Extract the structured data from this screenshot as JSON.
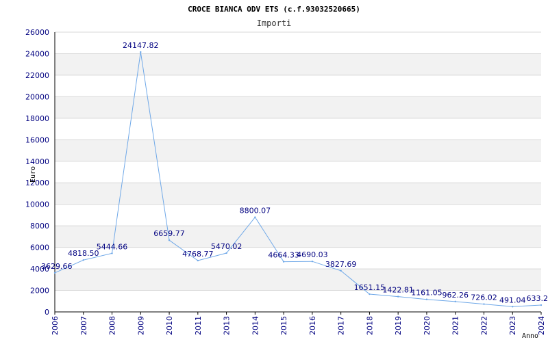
{
  "chart_data": {
    "type": "line",
    "title": "CROCE BIANCA ODV ETS (c.f.93032520665)",
    "subtitle": "Importi",
    "ylabel": "Euro",
    "xlabel": "Anno",
    "ylim": [
      0,
      26000
    ],
    "yticks": [
      0,
      2000,
      4000,
      6000,
      8000,
      10000,
      12000,
      14000,
      16000,
      18000,
      20000,
      22000,
      24000,
      26000
    ],
    "x": [
      "2006",
      "2007",
      "2008",
      "2009",
      "2010",
      "2011",
      "2013",
      "2014",
      "2015",
      "2016",
      "2017",
      "2018",
      "2019",
      "2020",
      "2021",
      "2022",
      "2023",
      "2024"
    ],
    "values": [
      3629.66,
      4818.5,
      5444.66,
      24147.82,
      6659.77,
      4768.77,
      5470.02,
      8800.07,
      4664.33,
      4690.03,
      3827.69,
      1651.15,
      1422.81,
      1161.05,
      962.26,
      726.02,
      491.04,
      633.2
    ],
    "labels": [
      "3629.66",
      "4818.50",
      "5444.66",
      "24147.82",
      "6659.77",
      "4768.77",
      "5470.02",
      "8800.07",
      "4664.33",
      "4690.03",
      "3827.69",
      "1651.15",
      "1422.81",
      "1161.05",
      "962.26",
      "726.02",
      "491.04",
      "633.2"
    ],
    "grid": "horizontal bands",
    "colors": {
      "line": "#6fa8e8",
      "text": "#000080",
      "band": "#f2f2f2",
      "grid": "#d8d8d8",
      "axis": "#000000"
    }
  }
}
